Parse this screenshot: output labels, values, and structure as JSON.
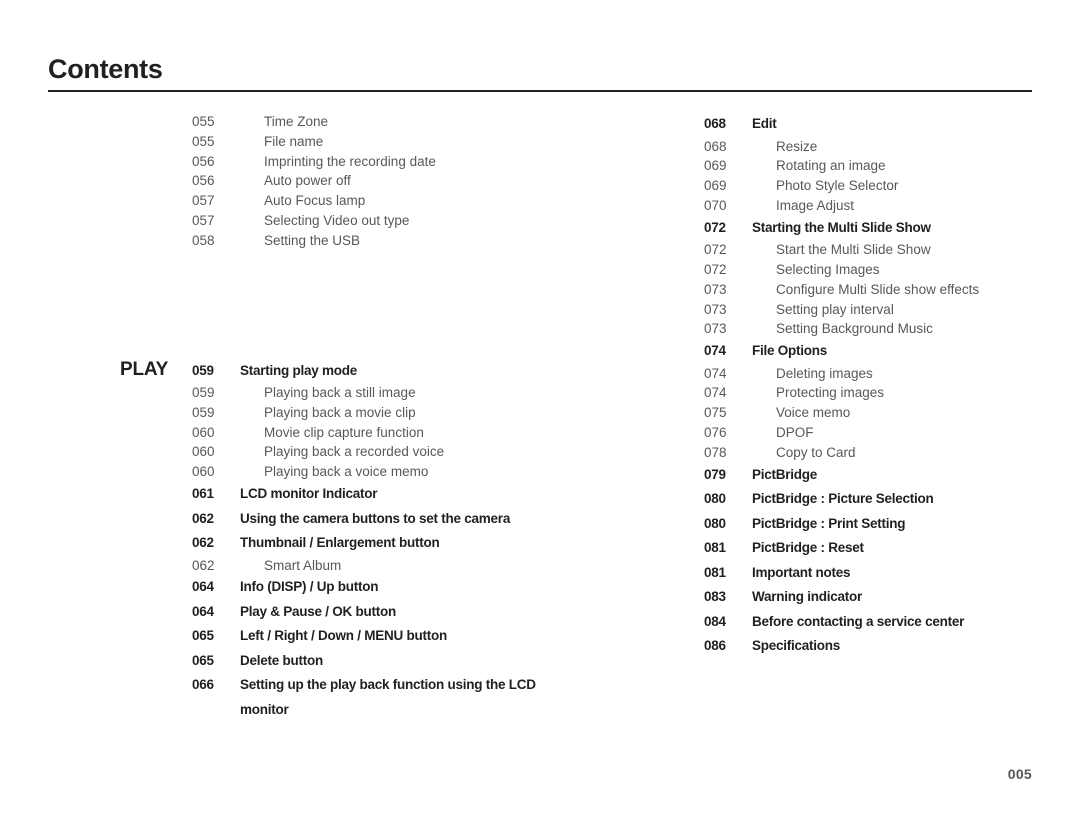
{
  "document": {
    "heading": "Contents",
    "folio": "005"
  },
  "columns": {
    "left": [
      {
        "label": "",
        "entries": [
          {
            "num": "055",
            "text": "Time Zone",
            "level": "sub"
          },
          {
            "num": "055",
            "text": "File name",
            "level": "sub"
          },
          {
            "num": "056",
            "text": "Imprinting the recording date",
            "level": "sub"
          },
          {
            "num": "056",
            "text": "Auto power off",
            "level": "sub"
          },
          {
            "num": "057",
            "text": "Auto Focus lamp",
            "level": "sub"
          },
          {
            "num": "057",
            "text": "Selecting Video out type",
            "level": "sub"
          },
          {
            "num": "058",
            "text": "Setting the USB",
            "level": "sub"
          }
        ]
      },
      {
        "label": "PLAY",
        "entries": [
          {
            "num": "059",
            "text": "Starting play mode",
            "level": "main"
          },
          {
            "num": "059",
            "text": "Playing back a still image",
            "level": "sub"
          },
          {
            "num": "059",
            "text": "Playing back a movie clip",
            "level": "sub"
          },
          {
            "num": "060",
            "text": "Movie clip capture function",
            "level": "sub"
          },
          {
            "num": "060",
            "text": "Playing back a recorded voice",
            "level": "sub"
          },
          {
            "num": "060",
            "text": "Playing back a voice memo",
            "level": "sub"
          },
          {
            "num": "061",
            "text": "LCD monitor Indicator",
            "level": "main"
          },
          {
            "num": "062",
            "text": "Using the camera buttons to set the camera",
            "level": "main"
          },
          {
            "num": "062",
            "text": "Thumbnail / Enlargement button",
            "level": "main"
          },
          {
            "num": "062",
            "text": "Smart Album",
            "level": "sub"
          },
          {
            "num": "064",
            "text": "Info (DISP) / Up button",
            "level": "main"
          },
          {
            "num": "064",
            "text": "Play & Pause / OK button",
            "level": "main"
          },
          {
            "num": "065",
            "text": "Left / Right / Down / MENU button",
            "level": "main"
          },
          {
            "num": "065",
            "text": "Delete button",
            "level": "main"
          },
          {
            "num": "066",
            "text": "Setting up the play back function using the LCD monitor",
            "level": "main"
          }
        ]
      }
    ],
    "right": [
      {
        "label": "",
        "entries": [
          {
            "num": "068",
            "text": "Edit",
            "level": "main"
          },
          {
            "num": "068",
            "text": "Resize",
            "level": "sub"
          },
          {
            "num": "069",
            "text": "Rotating an image",
            "level": "sub"
          },
          {
            "num": "069",
            "text": "Photo Style Selector",
            "level": "sub"
          },
          {
            "num": "070",
            "text": "Image Adjust",
            "level": "sub"
          },
          {
            "num": "072",
            "text": "Starting the Multi Slide Show",
            "level": "main"
          },
          {
            "num": "072",
            "text": "Start the Multi Slide Show",
            "level": "sub"
          },
          {
            "num": "072",
            "text": "Selecting Images",
            "level": "sub"
          },
          {
            "num": "073",
            "text": "Configure Multi Slide show effects",
            "level": "sub"
          },
          {
            "num": "073",
            "text": "Setting play interval",
            "level": "sub"
          },
          {
            "num": "073",
            "text": "Setting Background Music",
            "level": "sub"
          },
          {
            "num": "074",
            "text": "File Options",
            "level": "main"
          },
          {
            "num": "074",
            "text": "Deleting images",
            "level": "sub"
          },
          {
            "num": "074",
            "text": "Protecting images",
            "level": "sub"
          },
          {
            "num": "075",
            "text": "Voice memo",
            "level": "sub"
          },
          {
            "num": "076",
            "text": "DPOF",
            "level": "sub"
          },
          {
            "num": "078",
            "text": "Copy to Card",
            "level": "sub"
          },
          {
            "num": "079",
            "text": "PictBridge",
            "level": "main"
          },
          {
            "num": "080",
            "text": "PictBridge : Picture Selection",
            "level": "main"
          },
          {
            "num": "080",
            "text": "PictBridge : Print Setting",
            "level": "main"
          },
          {
            "num": "081",
            "text": "PictBridge : Reset",
            "level": "main"
          },
          {
            "num": "081",
            "text": "Important notes",
            "level": "main"
          },
          {
            "num": "083",
            "text": "Warning indicator",
            "level": "main"
          },
          {
            "num": "084",
            "text": "Before contacting a service center",
            "level": "main"
          },
          {
            "num": "086",
            "text": "Specifications",
            "level": "main"
          }
        ]
      }
    ]
  }
}
